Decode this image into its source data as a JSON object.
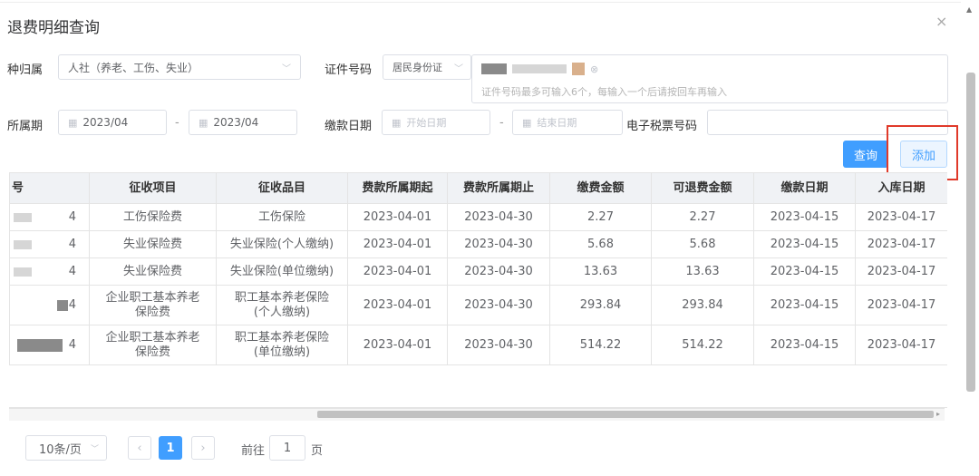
{
  "dialog": {
    "title": "退费明细查询",
    "close_glyph": "×"
  },
  "form": {
    "insurance_type_label": "种归属",
    "insurance_type_value": "人社（养老、工伤、失业）",
    "cert_no_label": "证件号码",
    "cert_type_value": "居民身份证",
    "cert_hint": "证件号码最多可输入6个，每输入一个后请按回车再输入",
    "period_label": "所属期",
    "period_start": "2023/04",
    "period_end": "2023/04",
    "range_sep": "-",
    "pay_date_label": "缴款日期",
    "pay_date_start_ph": "开始日期",
    "pay_date_end_ph": "结束日期",
    "tax_ticket_label": "电子税票号码"
  },
  "buttons": {
    "query": "查询",
    "add": "添加"
  },
  "table": {
    "headers": [
      "号",
      "征收项目",
      "征收品目",
      "费款所属期起",
      "费款所属期止",
      "缴费金额",
      "可退费金额",
      "缴款日期",
      "入库日期"
    ],
    "rows": [
      {
        "no": "4",
        "item": "工伤保险费",
        "sub": "工伤保险",
        "start": "2023-04-01",
        "end": "2023-04-30",
        "amount": "2.27",
        "refundable": "2.27",
        "pay_date": "2023-04-15",
        "store_date": "2023-04-17"
      },
      {
        "no": "4",
        "item": "失业保险费",
        "sub": "失业保险(个人缴纳)",
        "start": "2023-04-01",
        "end": "2023-04-30",
        "amount": "5.68",
        "refundable": "5.68",
        "pay_date": "2023-04-15",
        "store_date": "2023-04-17"
      },
      {
        "no": "4",
        "item": "失业保险费",
        "sub": "失业保险(单位缴纳)",
        "start": "2023-04-01",
        "end": "2023-04-30",
        "amount": "13.63",
        "refundable": "13.63",
        "pay_date": "2023-04-15",
        "store_date": "2023-04-17"
      },
      {
        "no": "4",
        "item": "企业职工基本养老保险费",
        "sub": "职工基本养老保险(个人缴纳)",
        "start": "2023-04-01",
        "end": "2023-04-30",
        "amount": "293.84",
        "refundable": "293.84",
        "pay_date": "2023-04-15",
        "store_date": "2023-04-17"
      },
      {
        "no": "4",
        "item": "企业职工基本养老保险费",
        "sub": "职工基本养老保险(单位缴纳)",
        "start": "2023-04-01",
        "end": "2023-04-30",
        "amount": "514.22",
        "refundable": "514.22",
        "pay_date": "2023-04-15",
        "store_date": "2023-04-17"
      }
    ]
  },
  "pagination": {
    "page_size": "10条/页",
    "current_page": "1",
    "goto_prefix": "前往",
    "goto_value": "1",
    "goto_suffix": "页"
  },
  "colors": {
    "primary": "#409eff",
    "highlight_frame": "#e03a2a"
  }
}
